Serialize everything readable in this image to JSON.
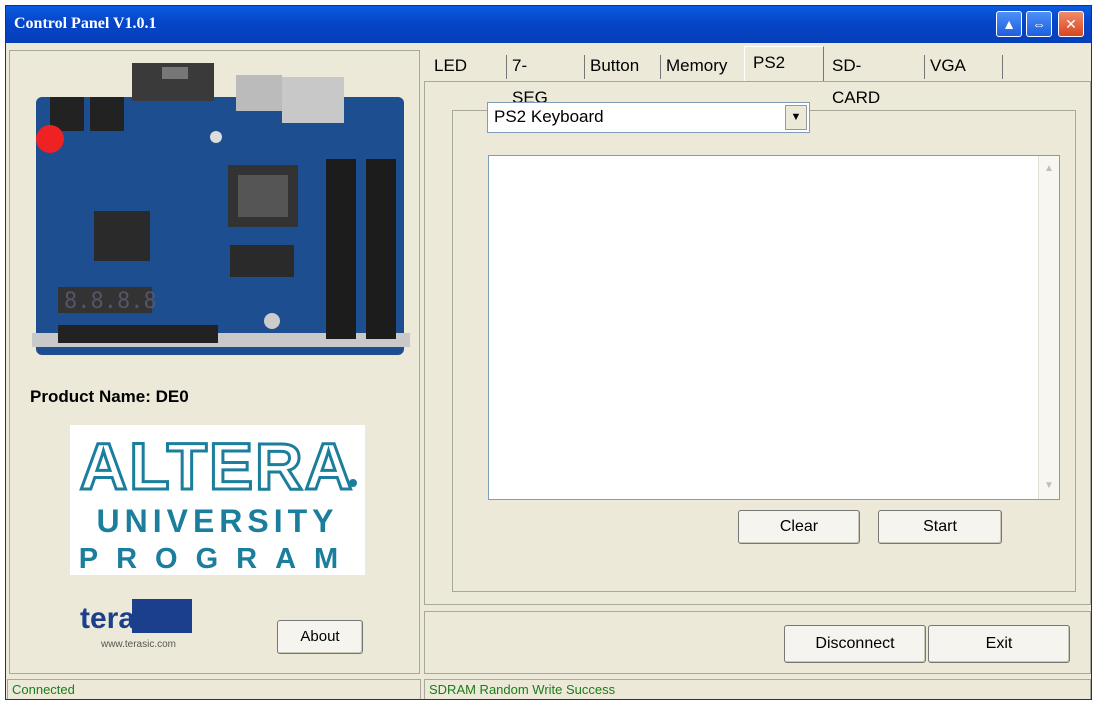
{
  "window": {
    "title": "Control Panel V1.0.1",
    "buttons": [
      {
        "name": "minimize-icon",
        "glyph": "▲"
      },
      {
        "name": "restore-icon",
        "glyph": "⇔"
      },
      {
        "name": "close-icon",
        "glyph": "✕"
      }
    ]
  },
  "left": {
    "product_name": "Product Name: DE0",
    "logo_text": "ALTERA",
    "logo_university": "UNIVERSITY",
    "logo_program": "PROGRAM",
    "terasic_text": "terasIC",
    "terasic_url": "www.terasic.com",
    "about_label": "About"
  },
  "tabs": [
    {
      "label": "LED",
      "active": false
    },
    {
      "label": "7-SEG",
      "active": false
    },
    {
      "label": "Button",
      "active": false
    },
    {
      "label": "Memory",
      "active": false
    },
    {
      "label": "PS2",
      "active": true
    },
    {
      "label": "SD-CARD",
      "active": false
    },
    {
      "label": "VGA",
      "active": false
    }
  ],
  "ps2": {
    "device_selected": "PS2 Keyboard",
    "output_text": "",
    "clear_label": "Clear",
    "start_label": "Start"
  },
  "bottom": {
    "disconnect_label": "Disconnect",
    "exit_label": "Exit"
  },
  "status": {
    "left": "Connected",
    "right": "SDRAM Random Write Success"
  },
  "colors": {
    "titlebar": "#0645c8",
    "status_text": "#1b7c1b",
    "logo_blue": "#1a7e9c"
  }
}
